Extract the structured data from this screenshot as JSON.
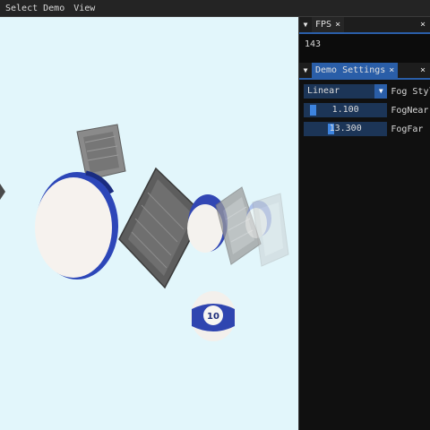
{
  "menubar": {
    "items": [
      "Select Demo",
      "View"
    ]
  },
  "fps_window": {
    "tab_label": "FPS",
    "value": "143",
    "close_glyph": "×"
  },
  "settings_window": {
    "tab_label": "Demo Settings",
    "close_glyph": "×",
    "fog_style": {
      "value": "Linear",
      "label": "Fog Style"
    },
    "fog_near": {
      "value": "1.100",
      "label": "FogNear",
      "fraction": 0.06
    },
    "fog_far": {
      "value": "13.300",
      "label": "FogFar",
      "fraction": 0.3
    }
  },
  "scene": {
    "ball_number": "10",
    "sky_color": "#e2f6fb"
  }
}
